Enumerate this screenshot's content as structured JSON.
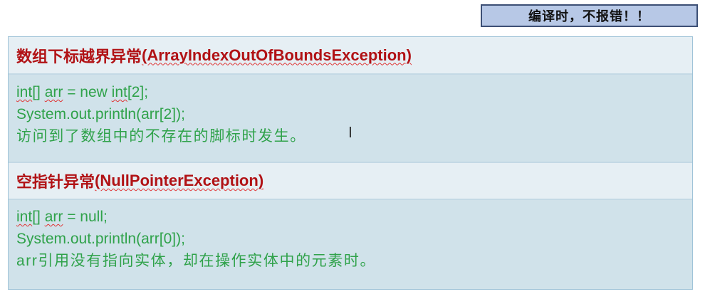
{
  "badge": {
    "text": "编译时，不报错！！"
  },
  "sections": [
    {
      "title_cn": "数组下标越界异常",
      "title_en": "(ArrayIndexOutOfBoundsException)",
      "lines": [
        "int[] arr = new int[2];",
        "System.out.println(arr[2]);",
        "访问到了数组中的不存在的脚标时发生。"
      ]
    },
    {
      "title_cn": "空指针异常",
      "title_en": "(NullPointerException)",
      "lines": [
        "int[] arr = null;",
        "System.out.println(arr[0]);",
        "arr引用没有指向实体，却在操作实体中的元素时。"
      ]
    }
  ],
  "colors": {
    "title": "#b11215",
    "body_text": "#2fa24a",
    "header_bg": "#e6eff4",
    "body_bg": "#d0e2ea",
    "badge_bg": "#b7c8e6"
  },
  "cursor_icon": "text-cursor-icon"
}
